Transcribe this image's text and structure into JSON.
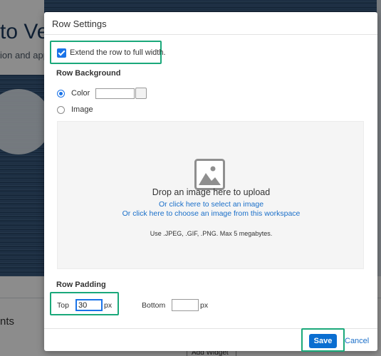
{
  "background_page": {
    "title_fragment": "to Ve",
    "subtitle_fragment": "ion and app",
    "section_fragment": "nts",
    "add_widget_label": "Add Widget"
  },
  "dialog": {
    "title": "Row Settings",
    "extend_checkbox": {
      "label": "Extend the row to full width.",
      "checked": true
    },
    "row_background": {
      "heading": "Row Background",
      "options": [
        {
          "label": "Color",
          "selected": true
        },
        {
          "label": "Image",
          "selected": false
        }
      ],
      "color_value": ""
    },
    "dropzone": {
      "icon": "image-placeholder-icon",
      "title": "Drop an image here to upload",
      "link_select": "Or click here to select an image",
      "link_workspace": "Or click here to choose an image from this workspace",
      "hint": "Use .JPEG, .GIF, .PNG. Max 5 megabytes."
    },
    "row_padding": {
      "heading": "Row Padding",
      "top_label": "Top",
      "top_value": "30",
      "bottom_label": "Bottom",
      "bottom_value": "",
      "unit": "px"
    },
    "footer": {
      "save_label": "Save",
      "cancel_label": "Cancel"
    }
  },
  "colors": {
    "accent_blue": "#0a6ed1",
    "link_blue": "#1a6fc9",
    "highlight_green": "#1aa87a"
  }
}
